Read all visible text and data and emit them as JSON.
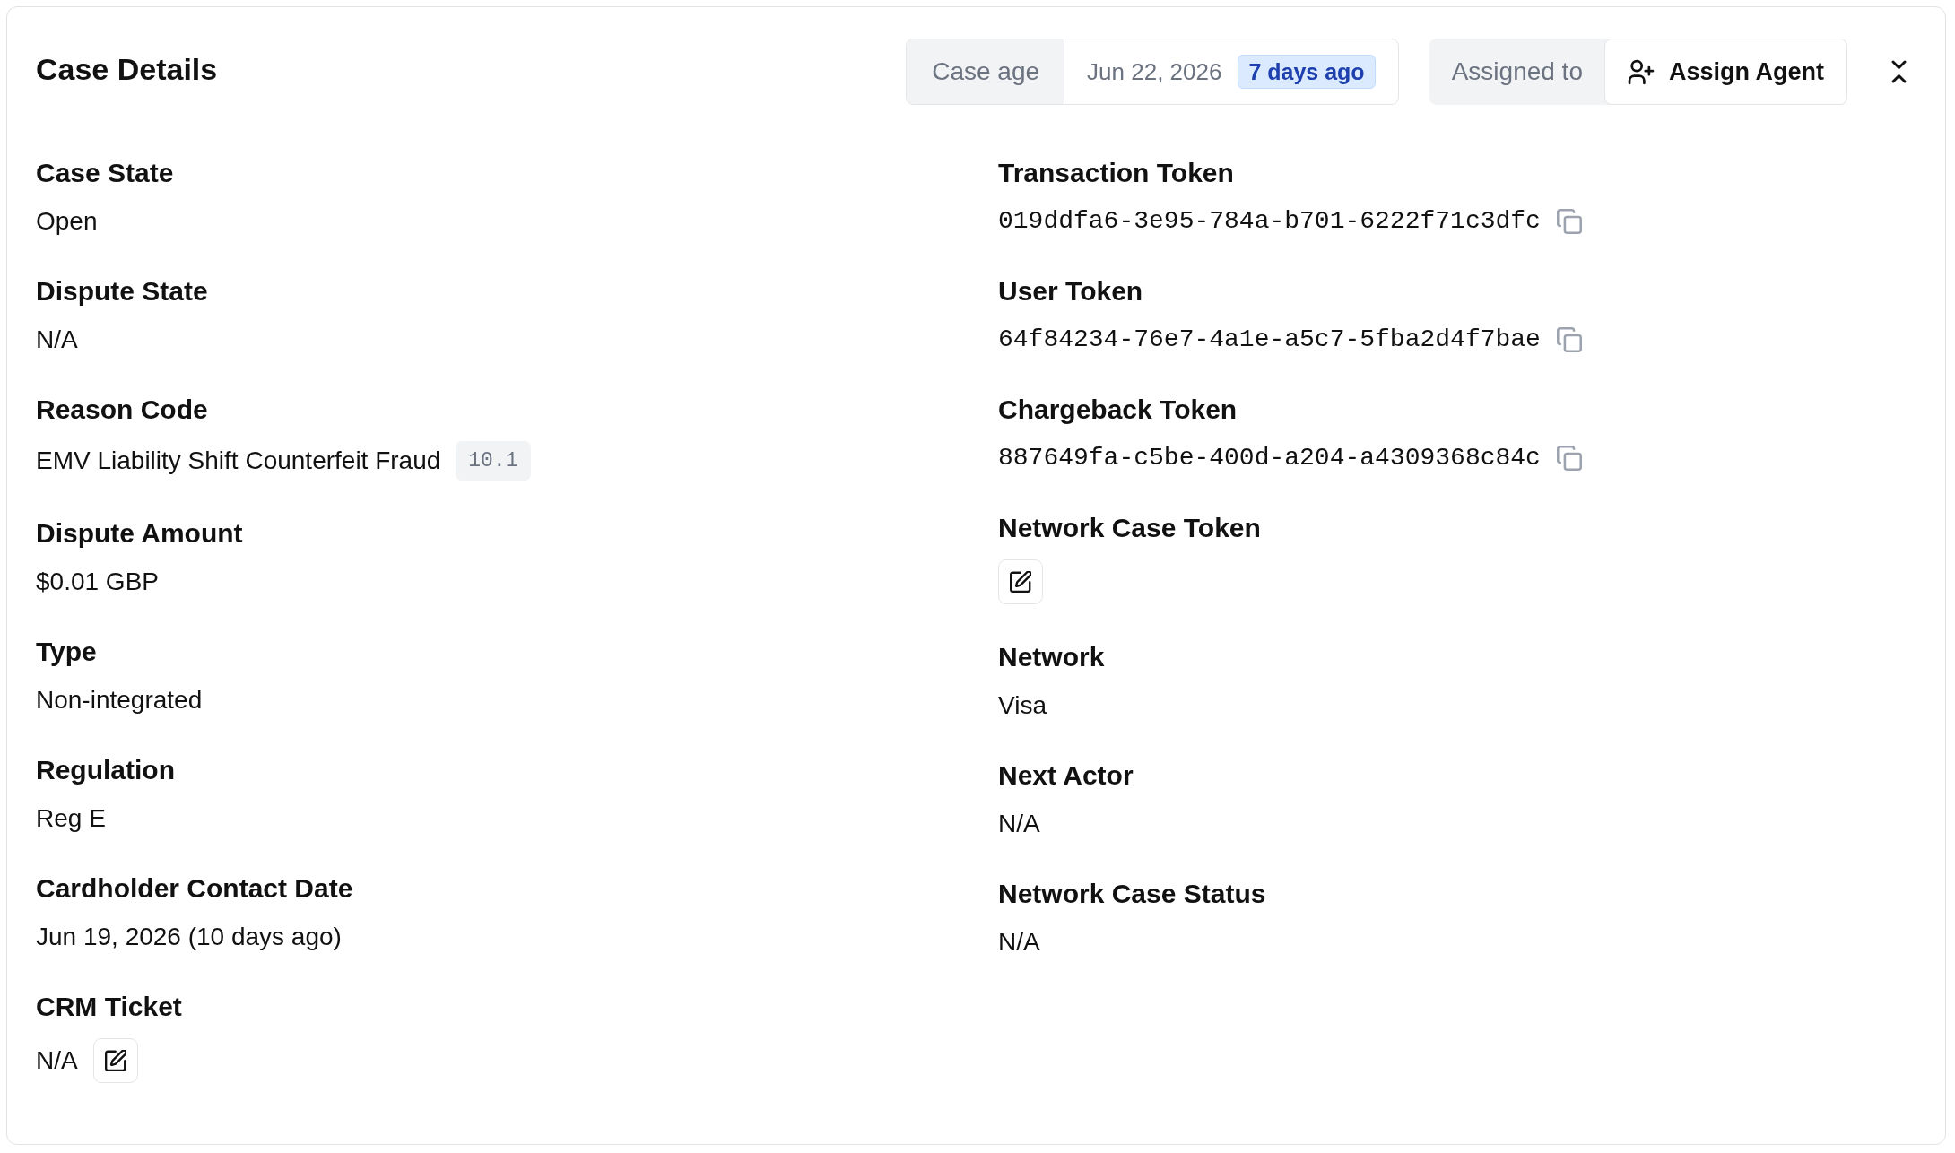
{
  "title": "Case Details",
  "case_age": {
    "label": "Case age",
    "date": "Jun 22, 2026",
    "relative": "7 days ago"
  },
  "assignment": {
    "label": "Assigned to",
    "button": "Assign Agent"
  },
  "left_fields": [
    {
      "kind": "text",
      "label": "Case State",
      "value": "Open"
    },
    {
      "kind": "text",
      "label": "Dispute State",
      "value": "N/A"
    },
    {
      "kind": "code",
      "label": "Reason Code",
      "value": "EMV Liability Shift Counterfeit Fraud",
      "code": "10.1"
    },
    {
      "kind": "text",
      "label": "Dispute Amount",
      "value": "$0.01 GBP"
    },
    {
      "kind": "text",
      "label": "Type",
      "value": "Non-integrated"
    },
    {
      "kind": "text",
      "label": "Regulation",
      "value": "Reg E"
    },
    {
      "kind": "text",
      "label": "Cardholder Contact Date",
      "value": "Jun 19, 2026 (10 days ago)"
    },
    {
      "kind": "editable",
      "label": "CRM Ticket",
      "value": "N/A"
    }
  ],
  "right_fields": [
    {
      "kind": "token",
      "label": "Transaction Token",
      "value": "019ddfa6-3e95-784a-b701-6222f71c3dfc"
    },
    {
      "kind": "token",
      "label": "User Token",
      "value": "64f84234-76e7-4a1e-a5c7-5fba2d4f7bae"
    },
    {
      "kind": "token",
      "label": "Chargeback Token",
      "value": "887649fa-c5be-400d-a204-a4309368c84c"
    },
    {
      "kind": "editable",
      "label": "Network Case Token"
    },
    {
      "kind": "text",
      "label": "Network",
      "value": "Visa"
    },
    {
      "kind": "text",
      "label": "Next Actor",
      "value": "N/A"
    },
    {
      "kind": "text",
      "label": "Network Case Status",
      "value": "N/A"
    }
  ]
}
